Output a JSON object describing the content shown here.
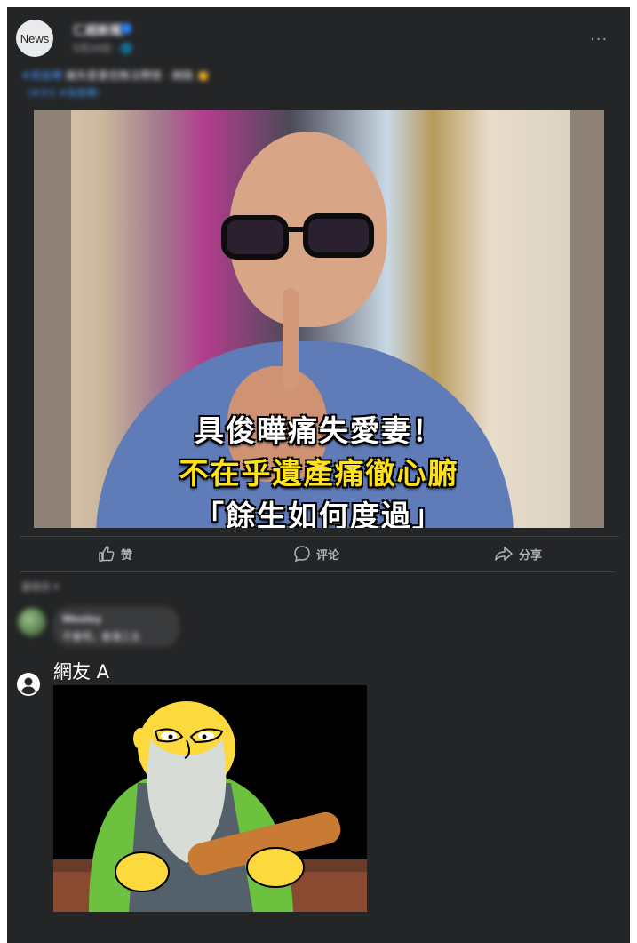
{
  "page": {
    "avatar_label": "News",
    "name": "ㄈ超新聞",
    "meta": "5月24日 · 🌐",
    "more_icon": "more-dots-icon",
    "caption_tag": "#具俊曄",
    "caption_text": "痛失愛妻但無法釋懷 · 網路",
    "caption_link": "（#大S #具俊曄）"
  },
  "post_image": {
    "overlay_line1": "具俊曄痛失愛妻！",
    "overlay_line2": "不在乎遺產痛徹心腑",
    "overlay_line3": "「餘生如何度過」",
    "overlay_colors": {
      "line1": "#ffffff",
      "line2": "#ffe21a",
      "line3": "#ffffff"
    }
  },
  "actions": {
    "like_label": "赞",
    "comment_label": "评论",
    "share_label": "分享",
    "like_icon": "thumbs-up-icon",
    "comment_icon": "speech-bubble-icon",
    "share_icon": "share-arrow-icon"
  },
  "comments": {
    "sort_label": "最相关 ▾",
    "first": {
      "name": "Wesley",
      "text": "不會吧，會滿三五"
    }
  },
  "reply": {
    "user_icon": "user-avatar-icon",
    "user_name": "網友 A",
    "image_icon": "meme-image"
  },
  "colors": {
    "card_bg": "#242526",
    "text_primary": "#e4e6eb",
    "text_secondary": "#b0b3b8",
    "link_blue": "#4599ff",
    "overlay_yellow": "#ffe21a"
  }
}
